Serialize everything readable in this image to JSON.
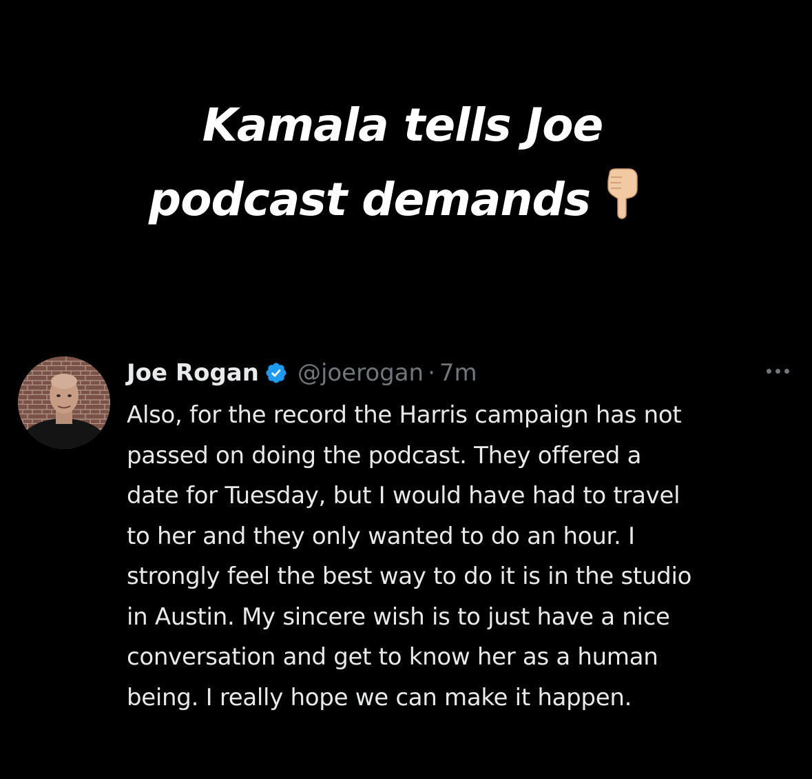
{
  "headline": {
    "line1": "Kamala tells Joe",
    "line2": "podcast demands",
    "emoji_icon": "backhand-index-pointing-down-icon"
  },
  "tweet": {
    "display_name": "Joe Rogan",
    "verified_icon": "verified-badge-icon",
    "verified_color": "#1d9bf0",
    "handle": "@joerogan",
    "separator": "·",
    "timestamp": "7m",
    "more_icon": "more-options-icon",
    "text": "Also, for the record the Harris campaign has not\npassed on doing the podcast.  They offered a\ndate for Tuesday, but I would have had to travel\nto her and they only wanted to do an hour.  I\nstrongly feel the best way to do it is in the studio\nin Austin.  My sincere wish is to just have a nice\nconversation and get to know her as a human\nbeing.  I really hope we can make it happen."
  },
  "colors": {
    "background": "#000000",
    "headline": "#ffffff",
    "primary_text": "#e7e9ea",
    "secondary_text": "#71767b"
  }
}
